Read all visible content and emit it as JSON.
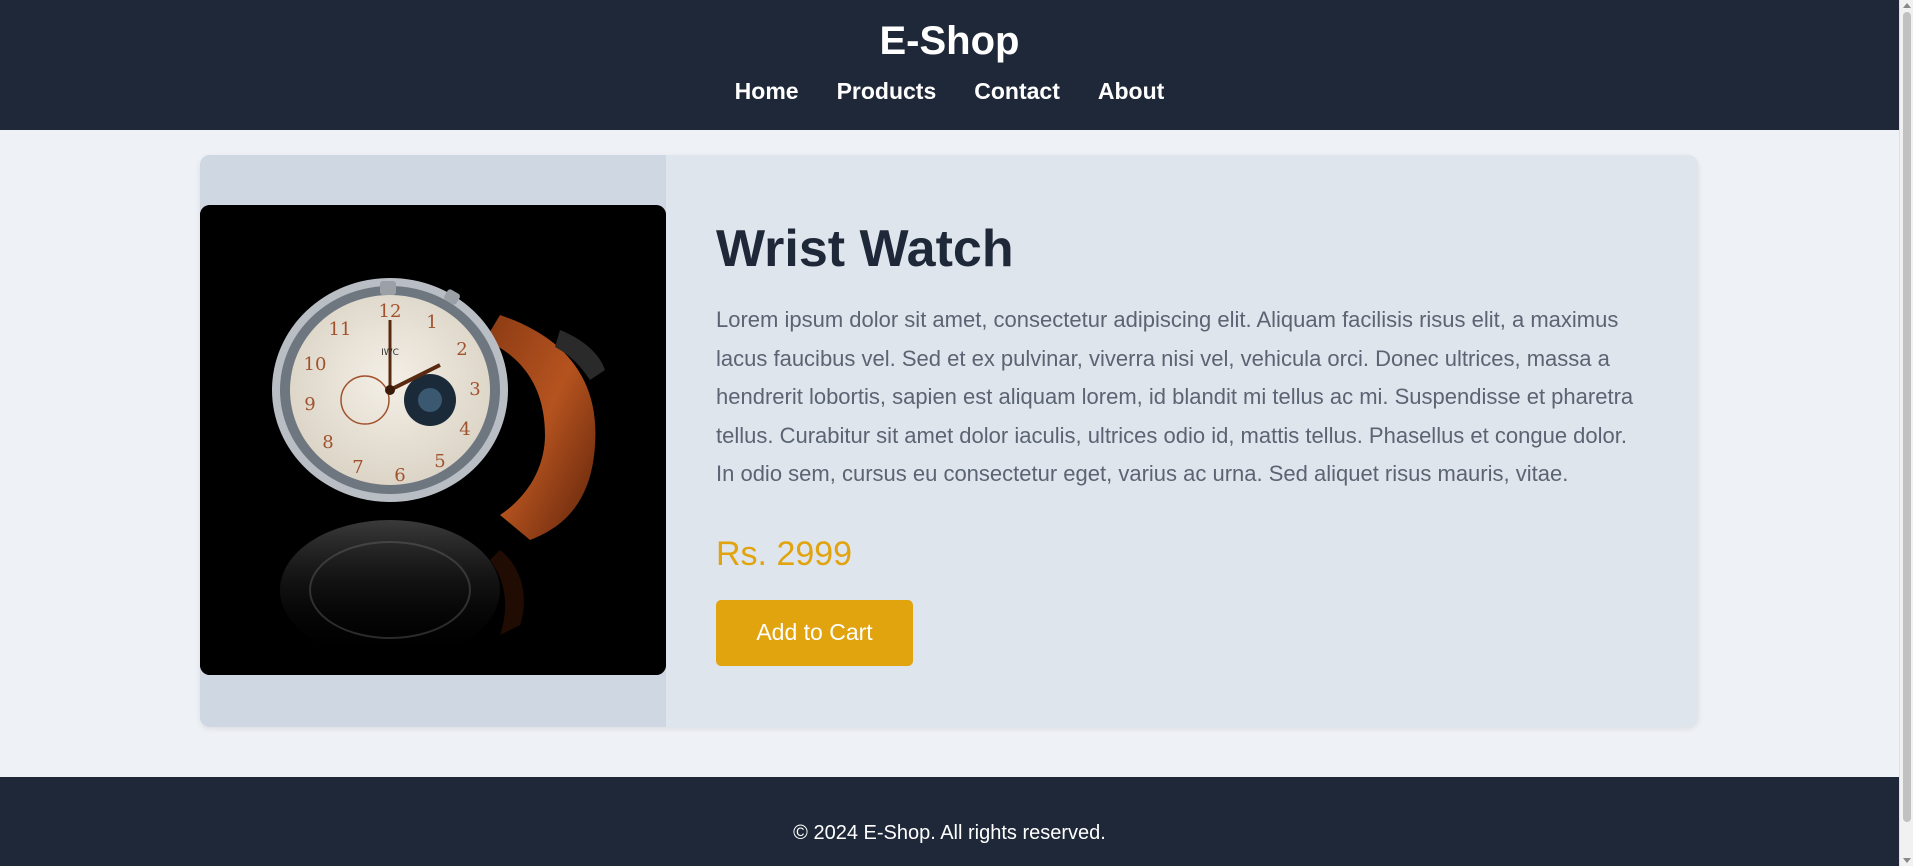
{
  "header": {
    "brand": "E-Shop",
    "nav": [
      "Home",
      "Products",
      "Contact",
      "About"
    ]
  },
  "product": {
    "image_alt": "Wrist watch photo",
    "title": "Wrist Watch",
    "description": "Lorem ipsum dolor sit amet, consectetur adipiscing elit. Aliquam facilisis risus elit, a maximus lacus faucibus vel. Sed et ex pulvinar, viverra nisi vel, vehicula orci. Donec ultrices, massa a hendrerit lobortis, sapien est aliquam lorem, id blandit mi tellus ac mi. Suspendisse et pharetra tellus. Curabitur sit amet dolor iaculis, ultrices odio id, mattis tellus. Phasellus et congue dolor. In odio sem, cursus eu consectetur eget, varius ac urna. Sed aliquet risus mauris, vitae.",
    "price": "Rs. 2999",
    "cart_label": "Add to Cart"
  },
  "footer": {
    "text": "© 2024 E-Shop. All rights reserved."
  },
  "colors": {
    "header_bg": "#1f2838",
    "accent": "#e1a40f",
    "card_bg": "#dfe5ed",
    "page_bg": "#eef1f5"
  }
}
